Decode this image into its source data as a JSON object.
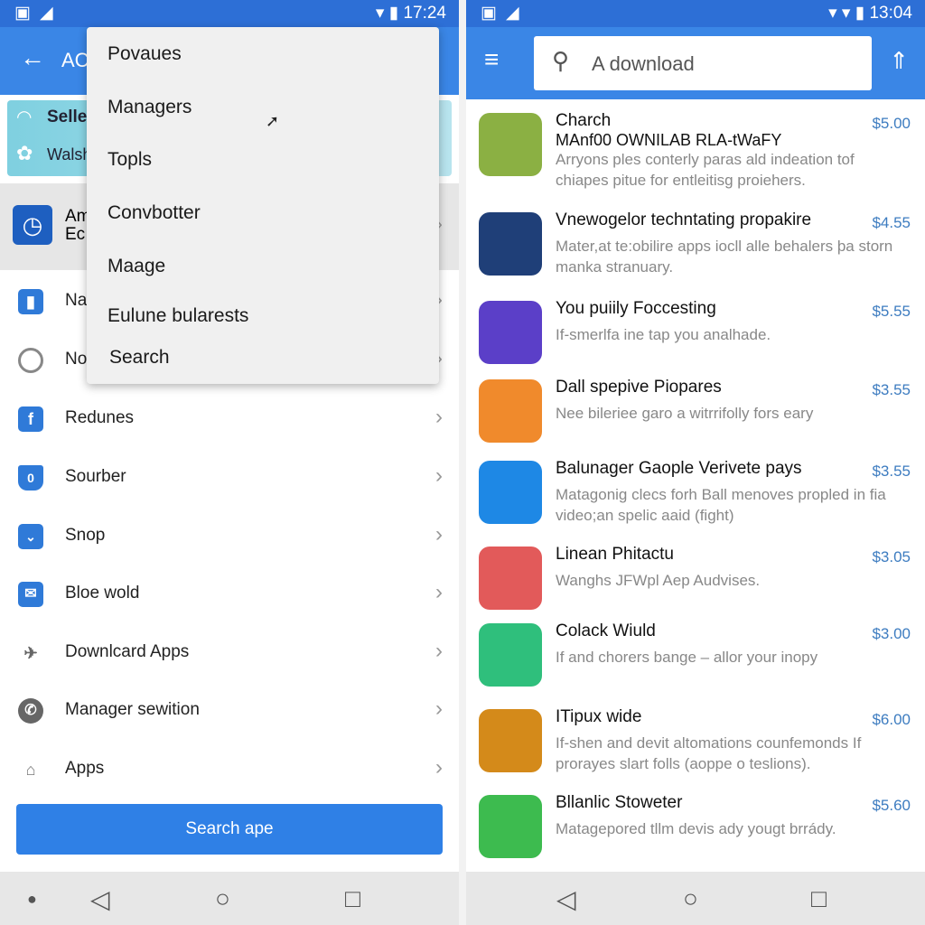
{
  "left": {
    "status": {
      "time": "17:24"
    },
    "appbar": {
      "title": "AC",
      "back_icon": "arrow-left-icon"
    },
    "banner": {
      "line1": "Selle",
      "line2": "Walsh"
    },
    "highlight_row": {
      "line1": "Am",
      "line2": "Ec"
    },
    "partial_rows": [
      "Na",
      "No"
    ],
    "rows": [
      {
        "label": "Redunes",
        "icon": "facebook-icon"
      },
      {
        "label": "Sourber",
        "icon": "shield-badge-icon"
      },
      {
        "label": "Snop",
        "icon": "briefcase-icon"
      },
      {
        "label": "Bloe wold",
        "icon": "mail-icon"
      },
      {
        "label": "Downlcard Apps",
        "icon": "plane-icon"
      },
      {
        "label": "Manager sewition",
        "icon": "phone-icon"
      },
      {
        "label": "Apps",
        "icon": "house-icon"
      }
    ],
    "button": "Search ape",
    "dropdown": [
      "Povaues",
      "Managers",
      "Topls",
      "Convbotter",
      "Maage",
      "Eulune bularests",
      "Search"
    ]
  },
  "right": {
    "status": {
      "time": "13:04"
    },
    "search": {
      "value": "A download"
    },
    "apps": [
      {
        "title": "Charch",
        "subtitle": "MAnf00 OWNILAB RLA-tWaFY",
        "desc": "Arryons ples conterly paras ald indeation tof chiapes pitue for entleitisg proiehers.",
        "price": "$5.00",
        "color": "#8bb043"
      },
      {
        "title": "Vnewogelor techntating propakire",
        "desc": "Mater,at te:obilire apps iocll alle behalers þa storn manka stranuary.",
        "price": "$4.55",
        "color": "#1f3f78"
      },
      {
        "title": "You puiily Foccesting",
        "desc": "If-smerlfa ine tap you analhade.",
        "price": "$5.55",
        "color": "#5b3fc8"
      },
      {
        "title": "Dall spepive Piopares",
        "desc": "Nee bileriee garo a witrrifolly fors eary",
        "price": "$3.55",
        "color": "#f08a2c"
      },
      {
        "title": "Balunager Gaople Verivete pays",
        "desc": "Matagonig clecs forh Ball menoves propled in fia video;an spelic aaid (fight)",
        "price": "$3.55",
        "color": "#1e88e5"
      },
      {
        "title": "Linean Phitactu",
        "desc": "Wanghs JFWpl Aep Audvises.",
        "price": "$3.05",
        "color": "#e25a5a"
      },
      {
        "title": "Colack Wiuld",
        "desc": "If and chorers bange – allor your inopy",
        "price": "$3.00",
        "color": "#2fbf7c"
      },
      {
        "title": "ITipux wide",
        "desc": "If-shen and devit altomations counfemonds If prorayes slart folls (aoppe o teslions).",
        "price": "$6.00",
        "color": "#d48a1a"
      },
      {
        "title": "Bllanlic Stoweter",
        "desc": "Matagepored tllm devis ady yougt brrády.",
        "price": "$5.60",
        "color": "#3dbb4f"
      }
    ]
  }
}
